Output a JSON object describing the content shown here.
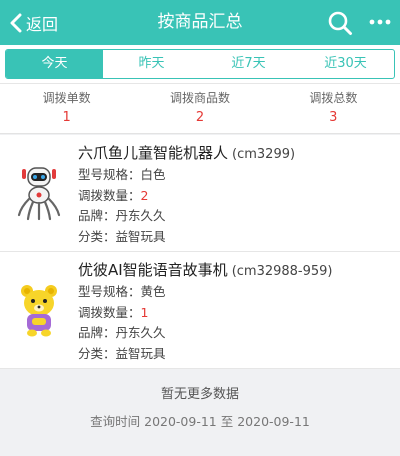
{
  "header": {
    "back_label": "返回",
    "title": "按商品汇总"
  },
  "tabs": [
    {
      "label": "今天",
      "active": true
    },
    {
      "label": "昨天",
      "active": false
    },
    {
      "label": "近7天",
      "active": false
    },
    {
      "label": "近30天",
      "active": false
    }
  ],
  "summary": [
    {
      "label": "调拨单数",
      "value": "1"
    },
    {
      "label": "调拨商品数",
      "value": "2"
    },
    {
      "label": "调拨总数",
      "value": "3"
    }
  ],
  "field_labels": {
    "spec": "型号规格：",
    "qty": "调拨数量：",
    "brand": "品牌：",
    "category": "分类："
  },
  "items": [
    {
      "name": "六爪鱼儿童智能机器人",
      "code": "(cm3299)",
      "spec": "白色",
      "qty": "2",
      "brand": "丹东久久",
      "category": "益智玩具",
      "image_icon": "robot-toy-image"
    },
    {
      "name": "优彼AI智能语音故事机",
      "code": "(cm32988-959)",
      "spec": "黄色",
      "qty": "1",
      "brand": "丹东久久",
      "category": "益智玩具",
      "image_icon": "bear-story-machine-image"
    }
  ],
  "footer": {
    "no_more": "暂无更多数据",
    "query_time": "查询时间 2020-09-11 至 2020-09-11"
  },
  "colors": {
    "accent": "#39c3b6",
    "highlight": "#e53935",
    "background": "#f0f1f3"
  }
}
